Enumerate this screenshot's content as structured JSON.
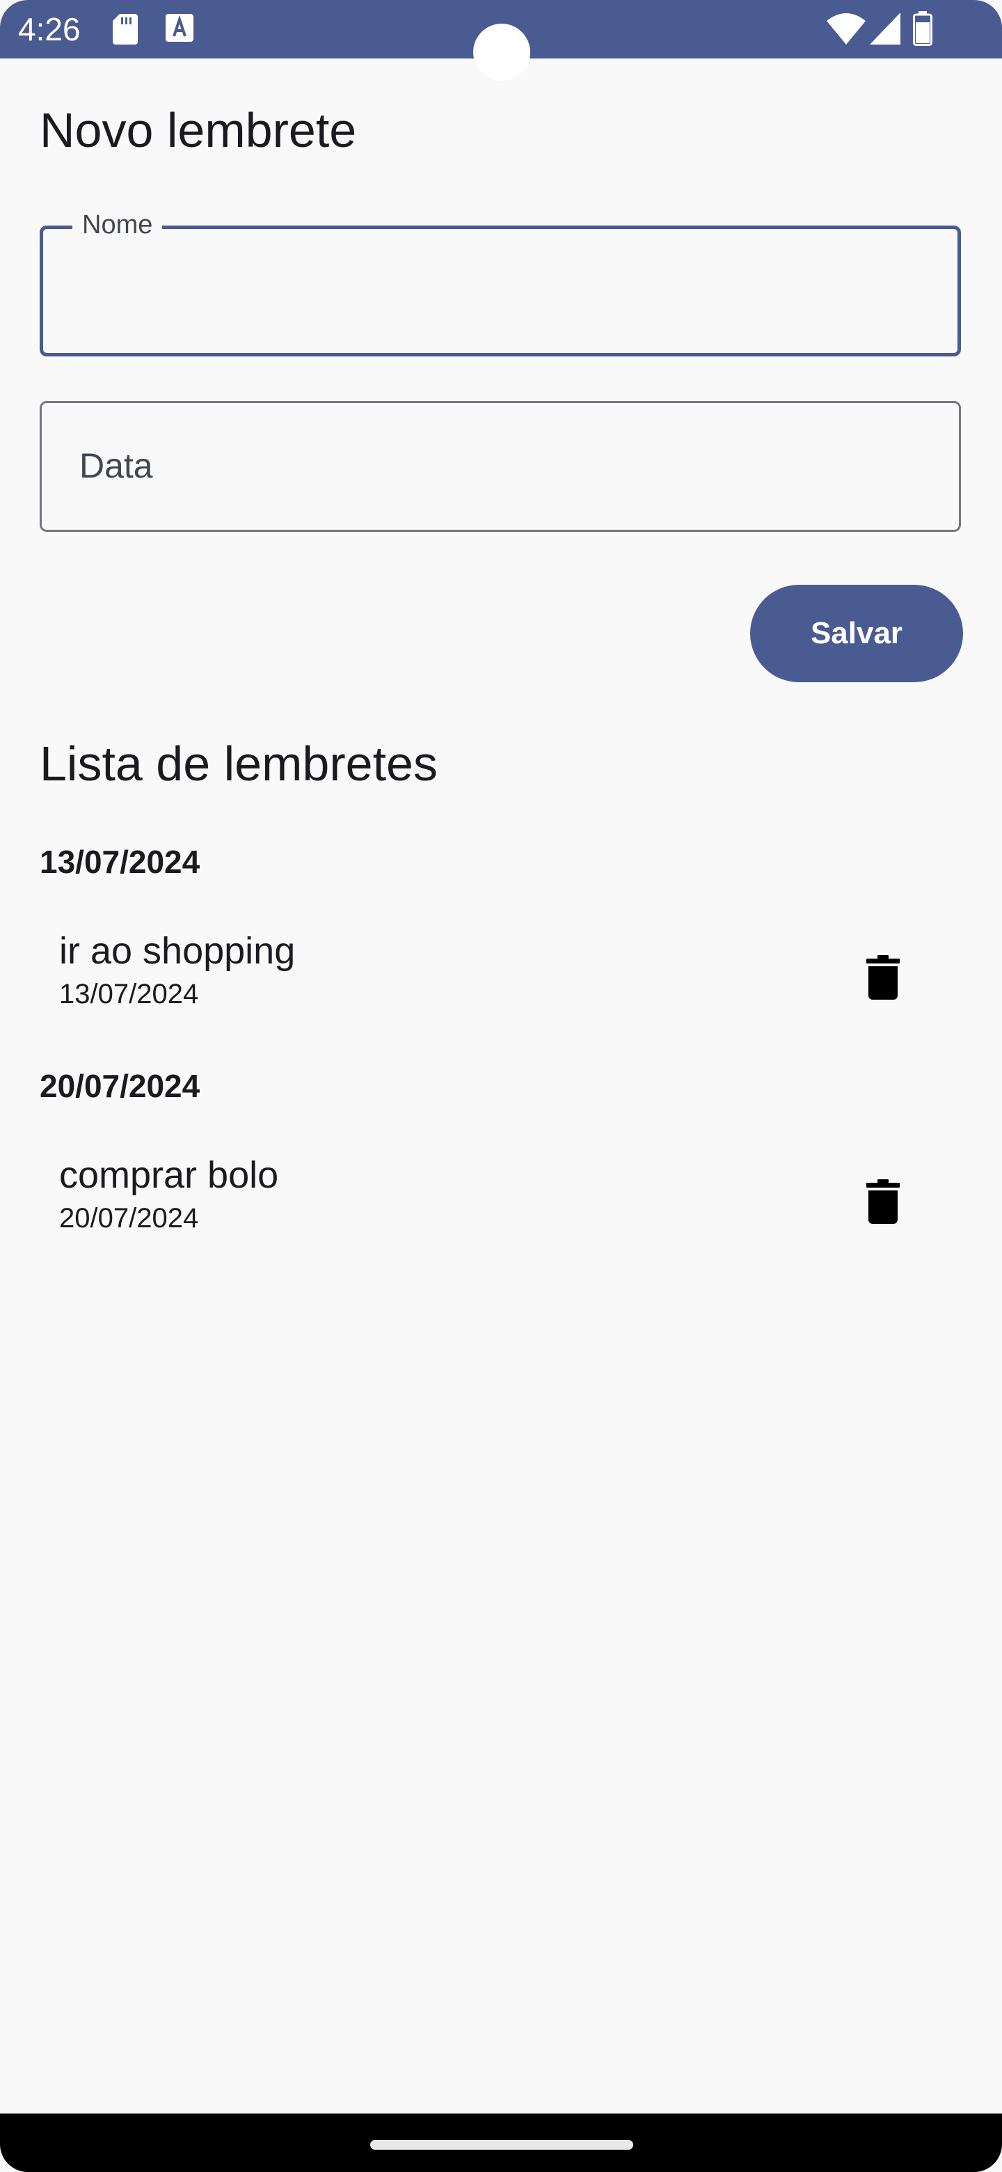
{
  "status_bar": {
    "time": "4:26",
    "icons": [
      "sd-card-icon",
      "text-a-icon",
      "wifi-icon",
      "signal-icon",
      "battery-icon"
    ]
  },
  "form": {
    "title": "Novo lembrete",
    "name_field": {
      "label": "Nome",
      "value": ""
    },
    "date_field": {
      "placeholder": "Data",
      "value": ""
    },
    "save_label": "Salvar"
  },
  "list": {
    "title": "Lista de lembretes",
    "groups": [
      {
        "date": "13/07/2024",
        "items": [
          {
            "title": "ir ao shopping",
            "date": "13/07/2024",
            "action_icon": "trash-icon"
          }
        ]
      },
      {
        "date": "20/07/2024",
        "items": [
          {
            "title": "comprar bolo",
            "date": "20/07/2024",
            "action_icon": "trash-icon"
          }
        ]
      }
    ]
  },
  "colors": {
    "primary": "#4a5b92",
    "background": "#f9f9fa",
    "text": "#1b1b1f",
    "outline": "#757780"
  }
}
